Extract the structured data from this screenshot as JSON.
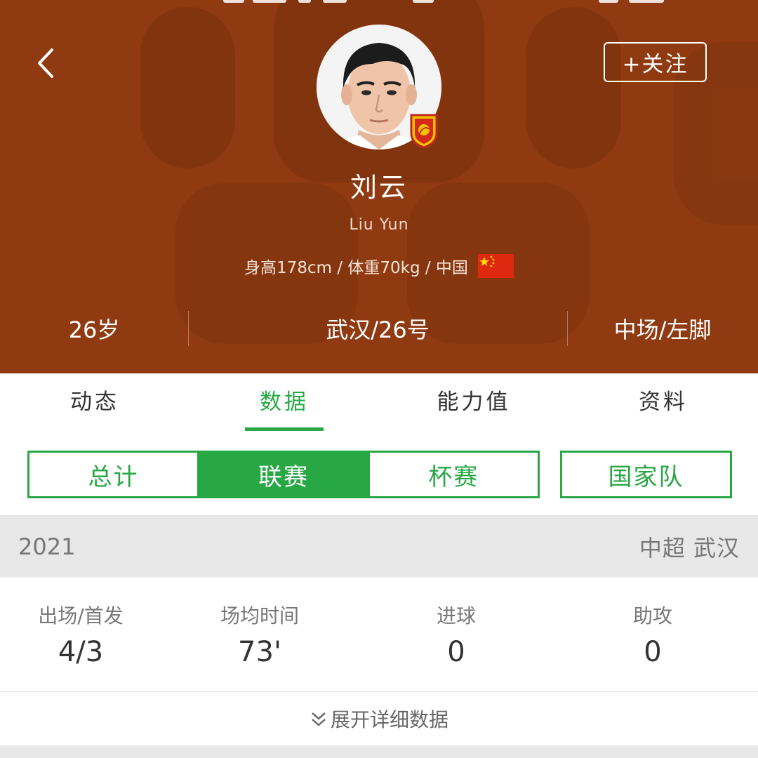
{
  "header": {
    "follow_label": "+关注",
    "player_name": "刘云",
    "player_name_en": "Liu Yun",
    "info": "身高178cm / 体重70kg / 中国",
    "age": "26岁",
    "team_number": "武汉/26号",
    "position_foot": "中场/左脚",
    "colors": {
      "background": "#8f3a10"
    }
  },
  "tabs": [
    {
      "label": "动态",
      "active": false
    },
    {
      "label": "数据",
      "active": true
    },
    {
      "label": "能力值",
      "active": false
    },
    {
      "label": "资料",
      "active": false
    }
  ],
  "segment": {
    "items": [
      {
        "label": "总计",
        "active": false
      },
      {
        "label": "联赛",
        "active": true
      },
      {
        "label": "杯赛",
        "active": false
      }
    ],
    "national_label": "国家队"
  },
  "season": {
    "year": "2021",
    "league_team": "中超 武汉"
  },
  "stats": [
    {
      "label": "出场/首发",
      "value": "4/3"
    },
    {
      "label": "场均时间",
      "value": "73'"
    },
    {
      "label": "进球",
      "value": "0"
    },
    {
      "label": "助攻",
      "value": "0"
    }
  ],
  "expand_label": "展开详细数据",
  "colors": {
    "accent": "#28a745"
  }
}
